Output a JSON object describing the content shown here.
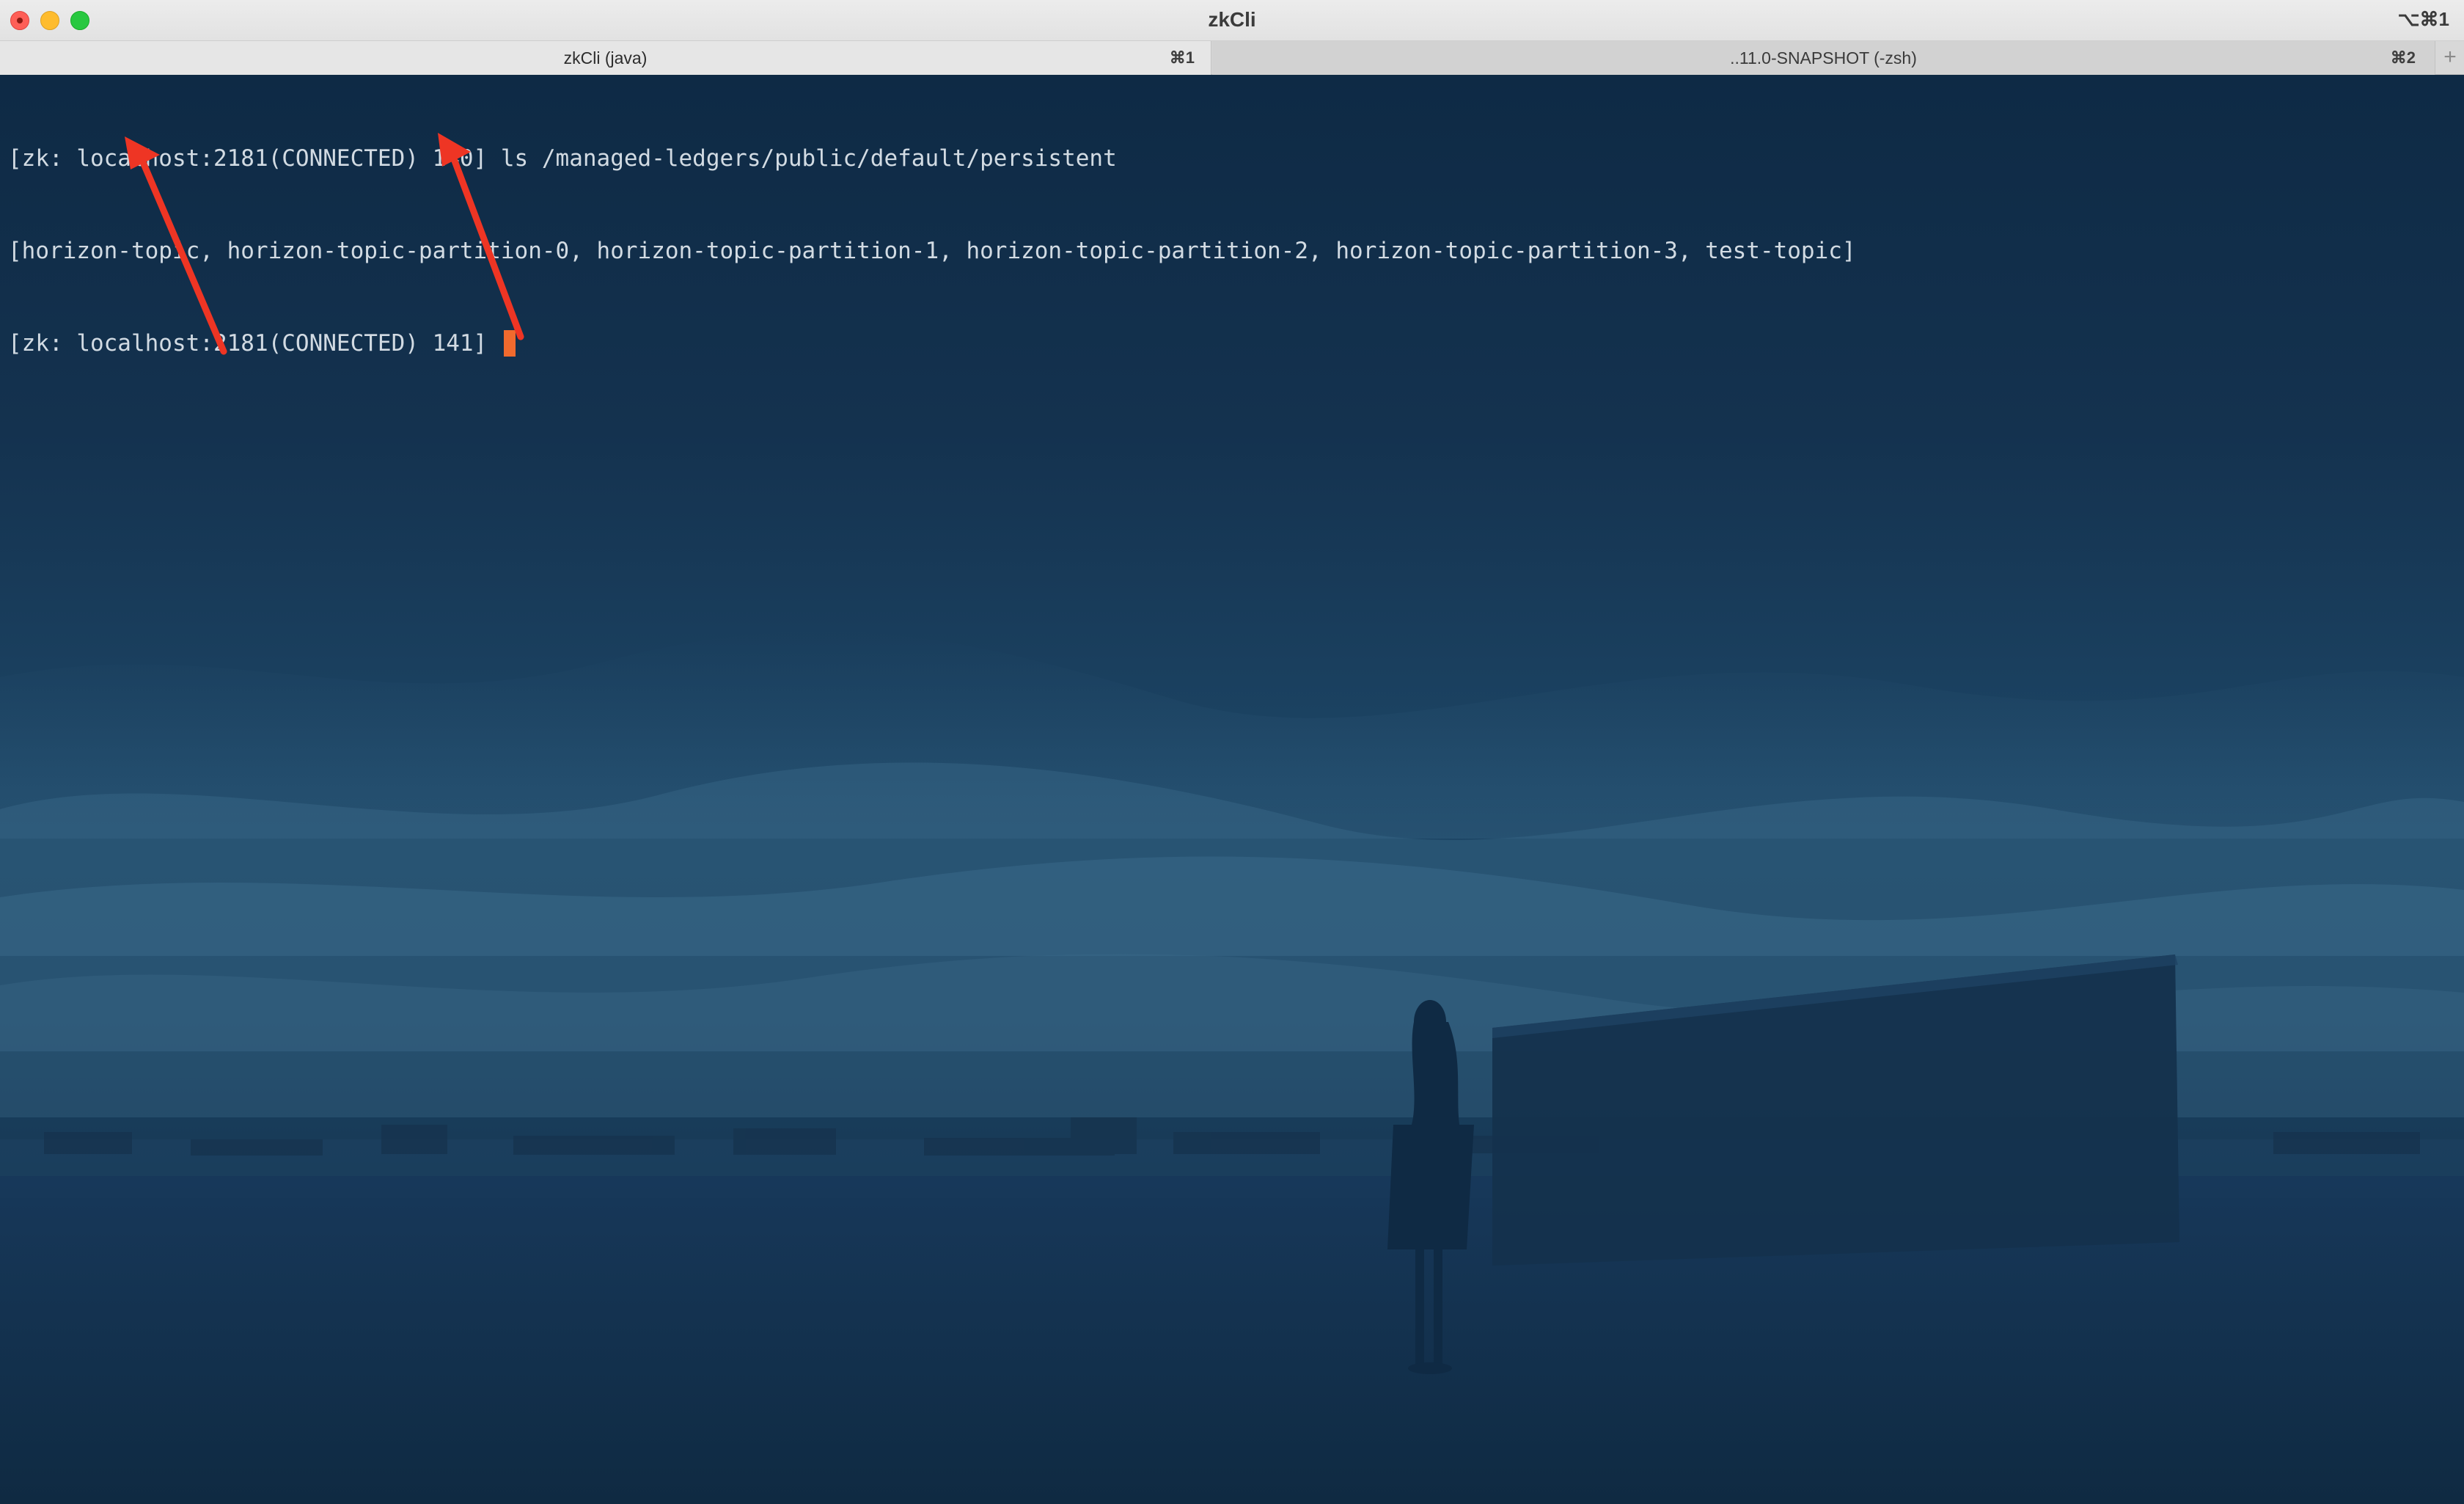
{
  "window": {
    "title": "zkCli",
    "shortcut": "⌥⌘1"
  },
  "tabs": [
    {
      "label": "zkCli (java)",
      "key": "⌘1",
      "active": true
    },
    {
      "label": "..11.0-SNAPSHOT (-zsh)",
      "key": "⌘2",
      "active": false
    }
  ],
  "new_tab_symbol": "+",
  "terminal": {
    "lines": [
      "[zk: localhost:2181(CONNECTED) 140] ls /managed-ledgers/public/default/persistent",
      "[horizon-topic, horizon-topic-partition-0, horizon-topic-partition-1, horizon-topic-partition-2, horizon-topic-partition-3, test-topic]",
      "[zk: localhost:2181(CONNECTED) 141] "
    ]
  },
  "colors": {
    "titlebar": "#e6e6e6",
    "terminal_text": "#d2dbe3",
    "cursor": "#f06a2e",
    "annotation_arrow": "#ee3524",
    "background": "#1b4260"
  }
}
